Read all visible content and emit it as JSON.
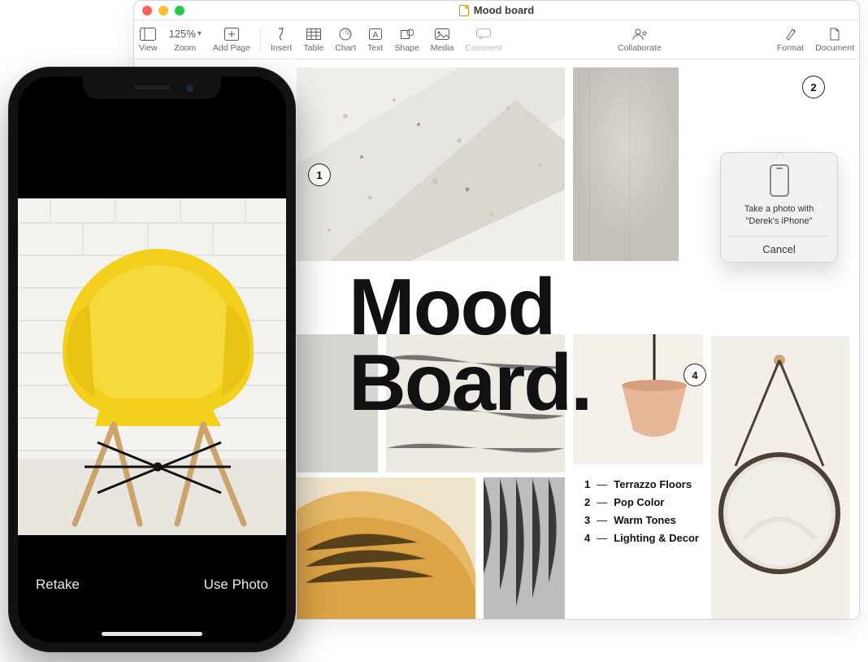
{
  "window": {
    "title": "Mood board",
    "traffic_colors": {
      "close": "#ff5f57",
      "min": "#febc2e",
      "max": "#28c840"
    }
  },
  "toolbar": {
    "view": "View",
    "zoom_label": "Zoom",
    "zoom_value": "125%",
    "add_page": "Add Page",
    "insert": "Insert",
    "table": "Table",
    "chart": "Chart",
    "text": "Text",
    "shape": "Shape",
    "media": "Media",
    "comment": "Comment",
    "collaborate": "Collaborate",
    "format": "Format",
    "document": "Document"
  },
  "document": {
    "headline_line1": "Mood",
    "headline_line2": "Board.",
    "callouts": {
      "n1": "1",
      "n2": "2",
      "n4": "4"
    },
    "legend": [
      {
        "num": "1",
        "label": "Terrazzo Floors"
      },
      {
        "num": "2",
        "label": "Pop Color"
      },
      {
        "num": "3",
        "label": "Warm Tones"
      },
      {
        "num": "4",
        "label": "Lighting & Decor"
      }
    ]
  },
  "popover": {
    "line1": "Take a photo with",
    "line2": "\"Derek's iPhone\"",
    "cancel": "Cancel"
  },
  "iphone": {
    "retake": "Retake",
    "use_photo": "Use Photo"
  }
}
